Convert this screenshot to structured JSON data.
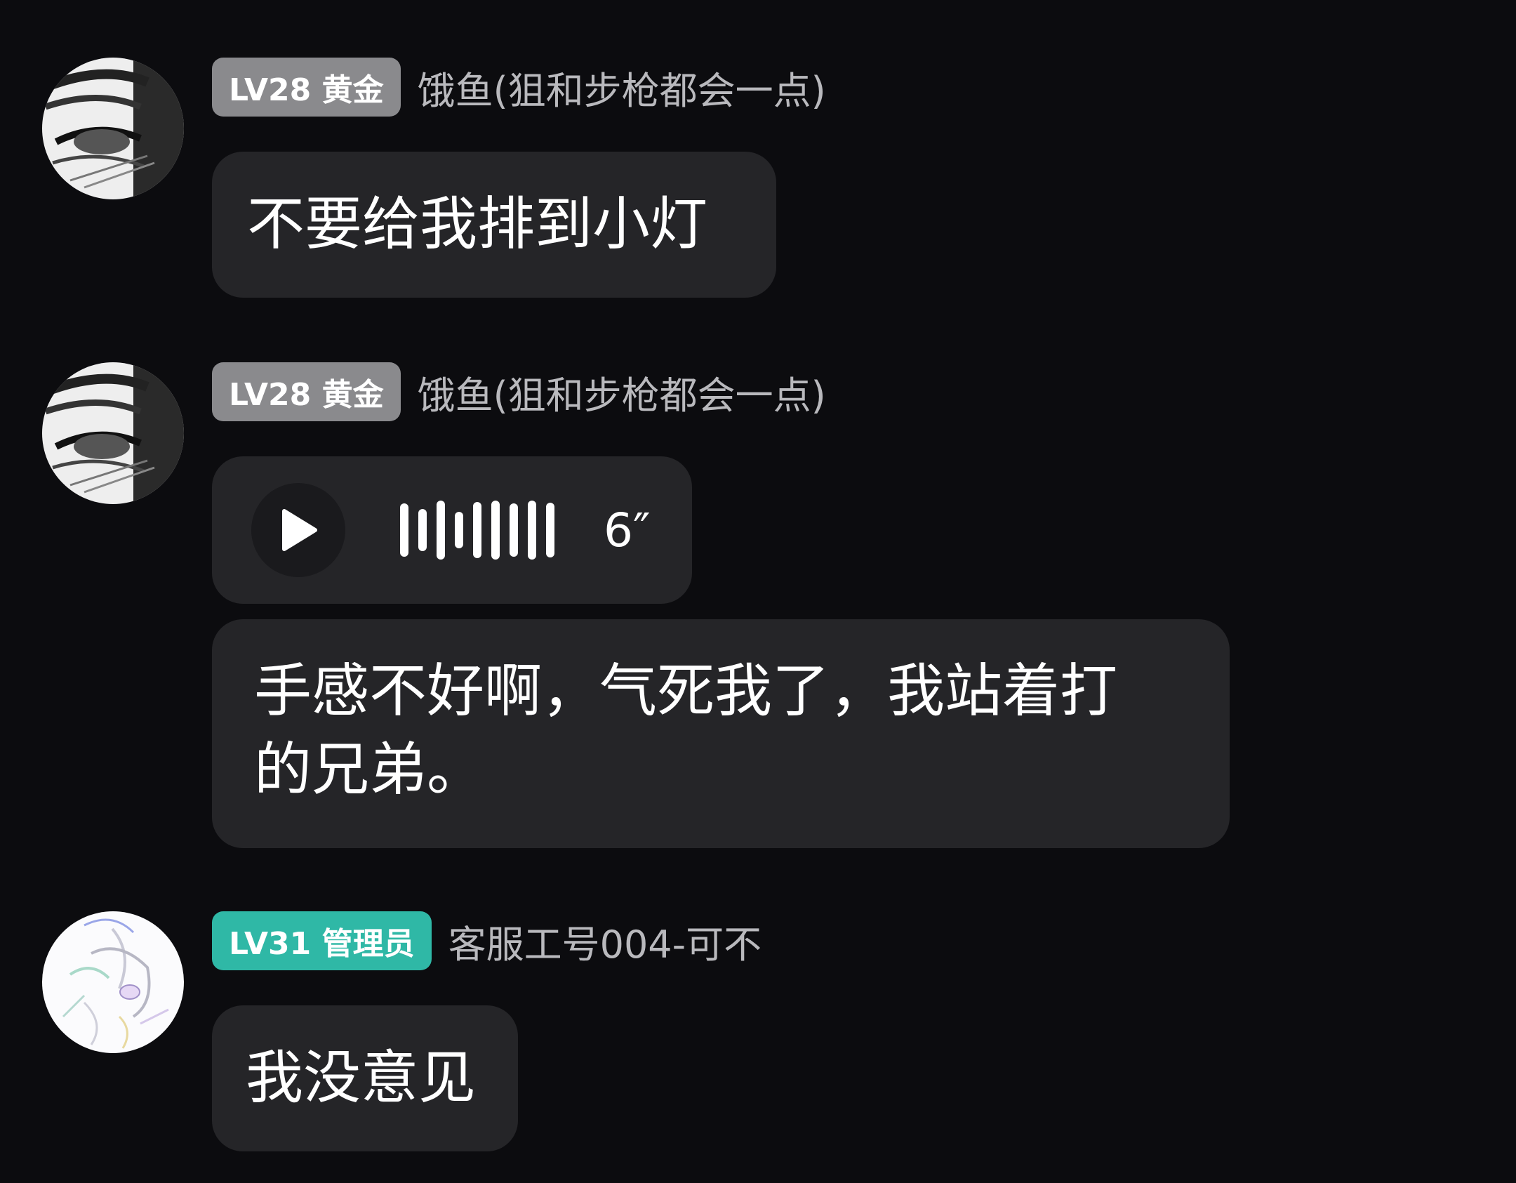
{
  "messages": [
    {
      "badge": "LV28 黄金",
      "username": "饿鱼(狙和步枪都会一点)",
      "text": "不要给我排到小灯"
    },
    {
      "badge": "LV28 黄金",
      "username": "饿鱼(狙和步枪都会一点)",
      "voice_duration": "6″",
      "text_line1": "手感不好啊，气死我了，我站着打",
      "text_line2": "的兄弟。"
    },
    {
      "badge": "LV31 管理员",
      "username": "客服工号004-可不",
      "text": "我没意见"
    }
  ],
  "colors": {
    "background": "#0c0c0f",
    "bubble": "#252528",
    "badge_gold": "#8a8a8d",
    "badge_admin": "#2fb8a6",
    "username": "#b9b9bd"
  },
  "icons": [
    "avatar-sketch-eye",
    "avatar-sketch-character",
    "play-icon",
    "voice-wave-icon"
  ]
}
